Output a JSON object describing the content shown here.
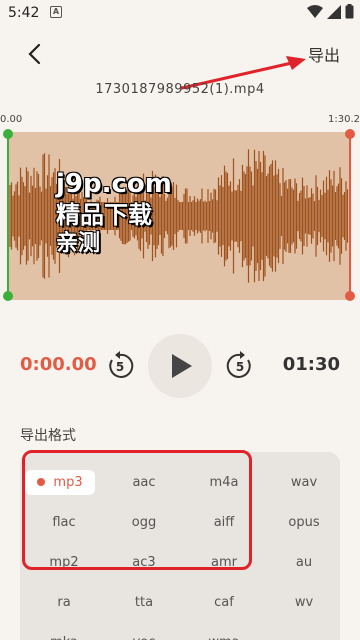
{
  "status": {
    "time": "5:42",
    "app_icon_letter": "A"
  },
  "header": {
    "export_label": "导出"
  },
  "file": {
    "name": "1730187989952(1).mp4"
  },
  "timeline": {
    "start": "0.00",
    "end": "1:30.2"
  },
  "watermark": {
    "line1": "j9p.com",
    "line2": "精品下载",
    "line3": "亲测"
  },
  "player": {
    "current_time": "0:00.00",
    "total_time": "01:30",
    "skip_seconds": "5"
  },
  "formats": {
    "title": "导出格式",
    "selected": "mp3",
    "items": [
      "mp3",
      "aac",
      "m4a",
      "wav",
      "flac",
      "ogg",
      "aiff",
      "opus",
      "mp2",
      "ac3",
      "amr",
      "au",
      "ra",
      "tta",
      "caf",
      "wv",
      "mka",
      "voc",
      "wma",
      ""
    ]
  },
  "colors": {
    "accent": "#e25b45",
    "wave_fill": "#a0521e",
    "wave_bg": "#e2c2a6",
    "handle_left": "#3ab03a",
    "handle_right": "#e25b45",
    "annotation": "#e0232b"
  }
}
